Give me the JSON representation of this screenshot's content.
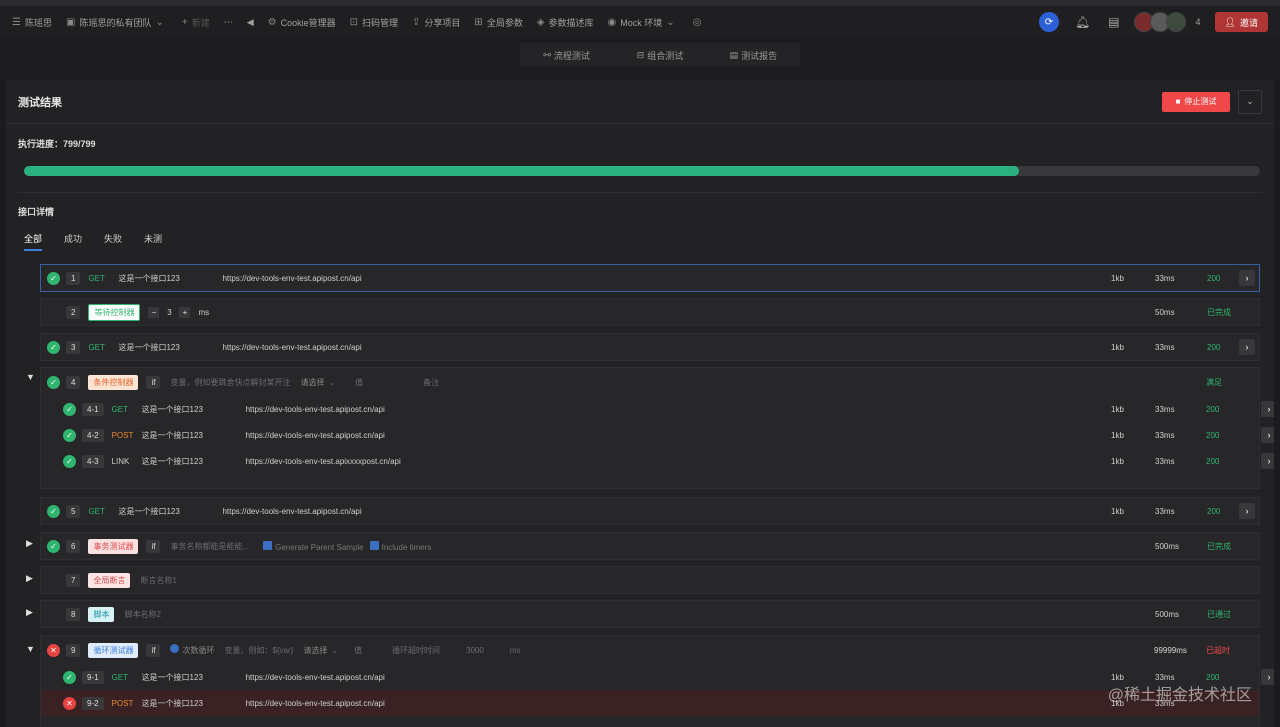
{
  "topbar": {
    "menu": "陈瑶思",
    "team": "陈瑶思的私有团队",
    "new": "新建",
    "cookie": "Cookie管理器",
    "scan": "扫码管理",
    "share": "分享项目",
    "global": "全局参数",
    "params": "参数描述库",
    "env": "Mock 环境",
    "avatar_count": "4",
    "invite": "邀请"
  },
  "modes": [
    "流程测试",
    "组合测试",
    "测试报告"
  ],
  "result": {
    "title": "测试结果",
    "stop": "停止测试",
    "progress_label": "执行进度：799/799",
    "progress_fraction": 0.805,
    "details_title": "接口详情",
    "tabs": [
      "全部",
      "成功",
      "失败",
      "未测"
    ]
  },
  "rows": {
    "r1": {
      "num": "1",
      "method": "GET",
      "name": "这是一个接口123",
      "url": "https://dev-tools-env-test.apipost.cn/api",
      "size": "1kb",
      "time": "33ms",
      "status": "200"
    },
    "r2": {
      "num": "2",
      "tag": "等待控制器",
      "value": "3",
      "unit": "ms",
      "time": "50ms",
      "status": "已完成"
    },
    "r3": {
      "num": "3",
      "method": "GET",
      "name": "这是一个接口123",
      "url": "https://dev-tools-env-test.apipost.cn/api",
      "size": "1kb",
      "time": "33ms",
      "status": "200"
    },
    "r4": {
      "num": "4",
      "tag": "条件控制器",
      "if": "if",
      "var": "变量，例如要跳舍快点解封某开注",
      "select": "请选择",
      "val": "值",
      "note": "备注",
      "status": "满足"
    },
    "r41": {
      "num": "4-1",
      "method": "GET",
      "name": "这是一个接口123",
      "url": "https://dev-tools-env-test.apipost.cn/api",
      "size": "1kb",
      "time": "33ms",
      "status": "200"
    },
    "r42": {
      "num": "4-2",
      "method": "POST",
      "name": "这是一个接口123",
      "url": "https://dev-tools-env-test.apipost.cn/api",
      "size": "1kb",
      "time": "33ms",
      "status": "200"
    },
    "r43": {
      "num": "4-3",
      "method": "LINK",
      "name": "这是一个接口123",
      "url": "https://dev-tools-env-test.apixxxxpost.cn/api",
      "size": "1kb",
      "time": "33ms",
      "status": "200"
    },
    "r5": {
      "num": "5",
      "method": "GET",
      "name": "这是一个接口123",
      "url": "https://dev-tools-env-test.apipost.cn/api",
      "size": "1kb",
      "time": "33ms",
      "status": "200"
    },
    "r6": {
      "num": "6",
      "tag": "事务测试器",
      "if": "if",
      "desc": "事务名称都能是能能...",
      "opt1": "Generate Parent Sample",
      "opt2": "Include timers",
      "time": "500ms",
      "status": "已完成"
    },
    "r7": {
      "num": "7",
      "tag": "全局断言",
      "desc": "断言名称1"
    },
    "r8": {
      "num": "8",
      "tag": "脚本",
      "desc": "脚本名称2",
      "time": "500ms",
      "status": "已通过"
    },
    "r9": {
      "num": "9",
      "tag": "循环测试器",
      "if": "if",
      "loop": "次数循环",
      "var": "变量、例如：${var}",
      "select": "请选择",
      "val": "值",
      "timeout_label": "循环超时时间",
      "timeout": "3000",
      "unit": "ms",
      "time": "99999ms",
      "status": "已超时"
    },
    "r91": {
      "num": "9-1",
      "method": "GET",
      "name": "这是一个接口123",
      "url": "https://dev-tools-env-test.apipost.cn/api",
      "size": "1kb",
      "time": "33ms",
      "status": "200"
    },
    "r92": {
      "num": "9-2",
      "method": "POST",
      "name": "这是一个接口123",
      "url": "https://dev-tools-env-test.apipost.cn/api",
      "size": "1kb",
      "time": "33ms"
    }
  },
  "watermark": "@稀土掘金技术社区"
}
